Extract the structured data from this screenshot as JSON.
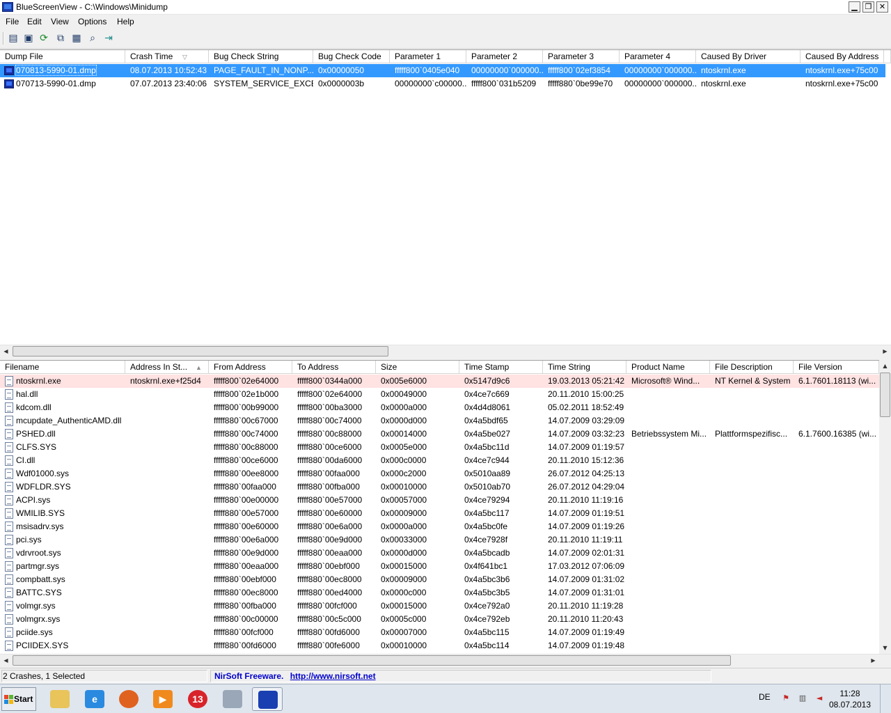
{
  "window": {
    "title": "BlueScreenView  -  C:\\Windows\\Minidump",
    "minimize_glyph": "▁",
    "restore_glyph": "❐",
    "close_glyph": "✕"
  },
  "menu": [
    "File",
    "Edit",
    "View",
    "Options",
    "Help"
  ],
  "toolbar_icons": [
    "properties-icon",
    "save-icon",
    "refresh-icon",
    "copy-icon",
    "html-report-icon",
    "find-icon",
    "exit-icon"
  ],
  "crashes": {
    "columns": [
      "Dump File",
      "Crash Time",
      "Bug Check String",
      "Bug Check Code",
      "Parameter 1",
      "Parameter 2",
      "Parameter 3",
      "Parameter 4",
      "Caused By Driver",
      "Caused By Address"
    ],
    "sort_column": "Crash Time",
    "sort_glyph": "▽",
    "rows": [
      [
        "070813-5990-01.dmp",
        "08.07.2013 10:52:43",
        "PAGE_FAULT_IN_NONP...",
        "0x00000050",
        "fffff800`0405e040",
        "00000000`000000...",
        "fffff800`02ef3854",
        "00000000`000000...",
        "ntoskrnl.exe",
        "ntoskrnl.exe+75c00"
      ],
      [
        "070713-5990-01.dmp",
        "07.07.2013 23:40:06",
        "SYSTEM_SERVICE_EXCE...",
        "0x0000003b",
        "00000000`c00000...",
        "fffff800`031b5209",
        "fffff880`0be99e70",
        "00000000`000000...",
        "ntoskrnl.exe",
        "ntoskrnl.exe+75c00"
      ]
    ],
    "selected_index": 0
  },
  "modules": {
    "columns": [
      "Filename",
      "Address In St...",
      "From Address",
      "To Address",
      "Size",
      "Time Stamp",
      "Time String",
      "Product Name",
      "File Description",
      "File Version"
    ],
    "sort_column": "Address In St...",
    "sort_glyph": "▲",
    "rows": [
      [
        "ntoskrnl.exe",
        "ntoskrnl.exe+f25d4",
        "fffff800`02e64000",
        "fffff800`0344a000",
        "0x005e6000",
        "0x5147d9c6",
        "19.03.2013 05:21:42",
        "Microsoft® Wind...",
        "NT Kernel & System",
        "6.1.7601.18113 (wi..."
      ],
      [
        "hal.dll",
        "",
        "fffff800`02e1b000",
        "fffff800`02e64000",
        "0x00049000",
        "0x4ce7c669",
        "20.11.2010 15:00:25",
        "",
        "",
        ""
      ],
      [
        "kdcom.dll",
        "",
        "fffff800`00b99000",
        "fffff800`00ba3000",
        "0x0000a000",
        "0x4d4d8061",
        "05.02.2011 18:52:49",
        "",
        "",
        ""
      ],
      [
        "mcupdate_AuthenticAMD.dll",
        "",
        "fffff880`00c67000",
        "fffff880`00c74000",
        "0x0000d000",
        "0x4a5bdf65",
        "14.07.2009 03:29:09",
        "",
        "",
        ""
      ],
      [
        "PSHED.dll",
        "",
        "fffff880`00c74000",
        "fffff880`00c88000",
        "0x00014000",
        "0x4a5be027",
        "14.07.2009 03:32:23",
        "Betriebssystem Mi...",
        "Plattformspezifisc...",
        "6.1.7600.16385 (wi..."
      ],
      [
        "CLFS.SYS",
        "",
        "fffff880`00c88000",
        "fffff880`00ce6000",
        "0x0005e000",
        "0x4a5bc11d",
        "14.07.2009 01:19:57",
        "",
        "",
        ""
      ],
      [
        "CI.dll",
        "",
        "fffff880`00ce6000",
        "fffff880`00da6000",
        "0x000c0000",
        "0x4ce7c944",
        "20.11.2010 15:12:36",
        "",
        "",
        ""
      ],
      [
        "Wdf01000.sys",
        "",
        "fffff880`00ee8000",
        "fffff880`00faa000",
        "0x000c2000",
        "0x5010aa89",
        "26.07.2012 04:25:13",
        "",
        "",
        ""
      ],
      [
        "WDFLDR.SYS",
        "",
        "fffff880`00faa000",
        "fffff880`00fba000",
        "0x00010000",
        "0x5010ab70",
        "26.07.2012 04:29:04",
        "",
        "",
        ""
      ],
      [
        "ACPI.sys",
        "",
        "fffff880`00e00000",
        "fffff880`00e57000",
        "0x00057000",
        "0x4ce79294",
        "20.11.2010 11:19:16",
        "",
        "",
        ""
      ],
      [
        "WMILIB.SYS",
        "",
        "fffff880`00e57000",
        "fffff880`00e60000",
        "0x00009000",
        "0x4a5bc117",
        "14.07.2009 01:19:51",
        "",
        "",
        ""
      ],
      [
        "msisadrv.sys",
        "",
        "fffff880`00e60000",
        "fffff880`00e6a000",
        "0x0000a000",
        "0x4a5bc0fe",
        "14.07.2009 01:19:26",
        "",
        "",
        ""
      ],
      [
        "pci.sys",
        "",
        "fffff880`00e6a000",
        "fffff880`00e9d000",
        "0x00033000",
        "0x4ce7928f",
        "20.11.2010 11:19:11",
        "",
        "",
        ""
      ],
      [
        "vdrvroot.sys",
        "",
        "fffff880`00e9d000",
        "fffff880`00eaa000",
        "0x0000d000",
        "0x4a5bcadb",
        "14.07.2009 02:01:31",
        "",
        "",
        ""
      ],
      [
        "partmgr.sys",
        "",
        "fffff880`00eaa000",
        "fffff880`00ebf000",
        "0x00015000",
        "0x4f641bc1",
        "17.03.2012 07:06:09",
        "",
        "",
        ""
      ],
      [
        "compbatt.sys",
        "",
        "fffff880`00ebf000",
        "fffff880`00ec8000",
        "0x00009000",
        "0x4a5bc3b6",
        "14.07.2009 01:31:02",
        "",
        "",
        ""
      ],
      [
        "BATTC.SYS",
        "",
        "fffff880`00ec8000",
        "fffff880`00ed4000",
        "0x0000c000",
        "0x4a5bc3b5",
        "14.07.2009 01:31:01",
        "",
        "",
        ""
      ],
      [
        "volmgr.sys",
        "",
        "fffff880`00fba000",
        "fffff880`00fcf000",
        "0x00015000",
        "0x4ce792a0",
        "20.11.2010 11:19:28",
        "",
        "",
        ""
      ],
      [
        "volmgrx.sys",
        "",
        "fffff880`00c00000",
        "fffff880`00c5c000",
        "0x0005c000",
        "0x4ce792eb",
        "20.11.2010 11:20:43",
        "",
        "",
        ""
      ],
      [
        "pciide.sys",
        "",
        "fffff880`00fcf000",
        "fffff880`00fd6000",
        "0x00007000",
        "0x4a5bc115",
        "14.07.2009 01:19:49",
        "",
        "",
        ""
      ],
      [
        "PCIIDEX.SYS",
        "",
        "fffff880`00fd6000",
        "fffff880`00fe6000",
        "0x00010000",
        "0x4a5bc114",
        "14.07.2009 01:19:48",
        "",
        "",
        ""
      ]
    ],
    "highlighted_index": 0
  },
  "status": {
    "count_text": "2 Crashes, 1 Selected",
    "freeware_text": "NirSoft Freeware.",
    "link_text": "http://www.nirsoft.net"
  },
  "scroll": {
    "left_glyph": "◀",
    "right_glyph": "▶",
    "up_glyph": "▲",
    "down_glyph": "▼"
  },
  "taskbar": {
    "start_label": "Start",
    "apps": [
      {
        "name": "explorer-icon",
        "glyph": "",
        "color": "#e8c45a"
      },
      {
        "name": "internet-explorer-icon",
        "glyph": "e",
        "color": "#2a8ae0"
      },
      {
        "name": "firefox-icon",
        "glyph": "",
        "color": "#e0621f"
      },
      {
        "name": "media-player-icon",
        "glyph": "▶",
        "color": "#f08a1e"
      },
      {
        "name": "nero-icon",
        "glyph": "13",
        "color": "#d8232a"
      },
      {
        "name": "calculator-icon",
        "glyph": "",
        "color": "#9aa7b8"
      },
      {
        "name": "bluescreenview-icon",
        "glyph": "",
        "color": "#1a3fb0"
      }
    ],
    "language": "DE",
    "clock_time": "11:28",
    "clock_date": "08.07.2013"
  },
  "colors": {
    "selection": "#3399ff",
    "highlight_row": "#ffe2e2",
    "link": "#0000cc"
  }
}
